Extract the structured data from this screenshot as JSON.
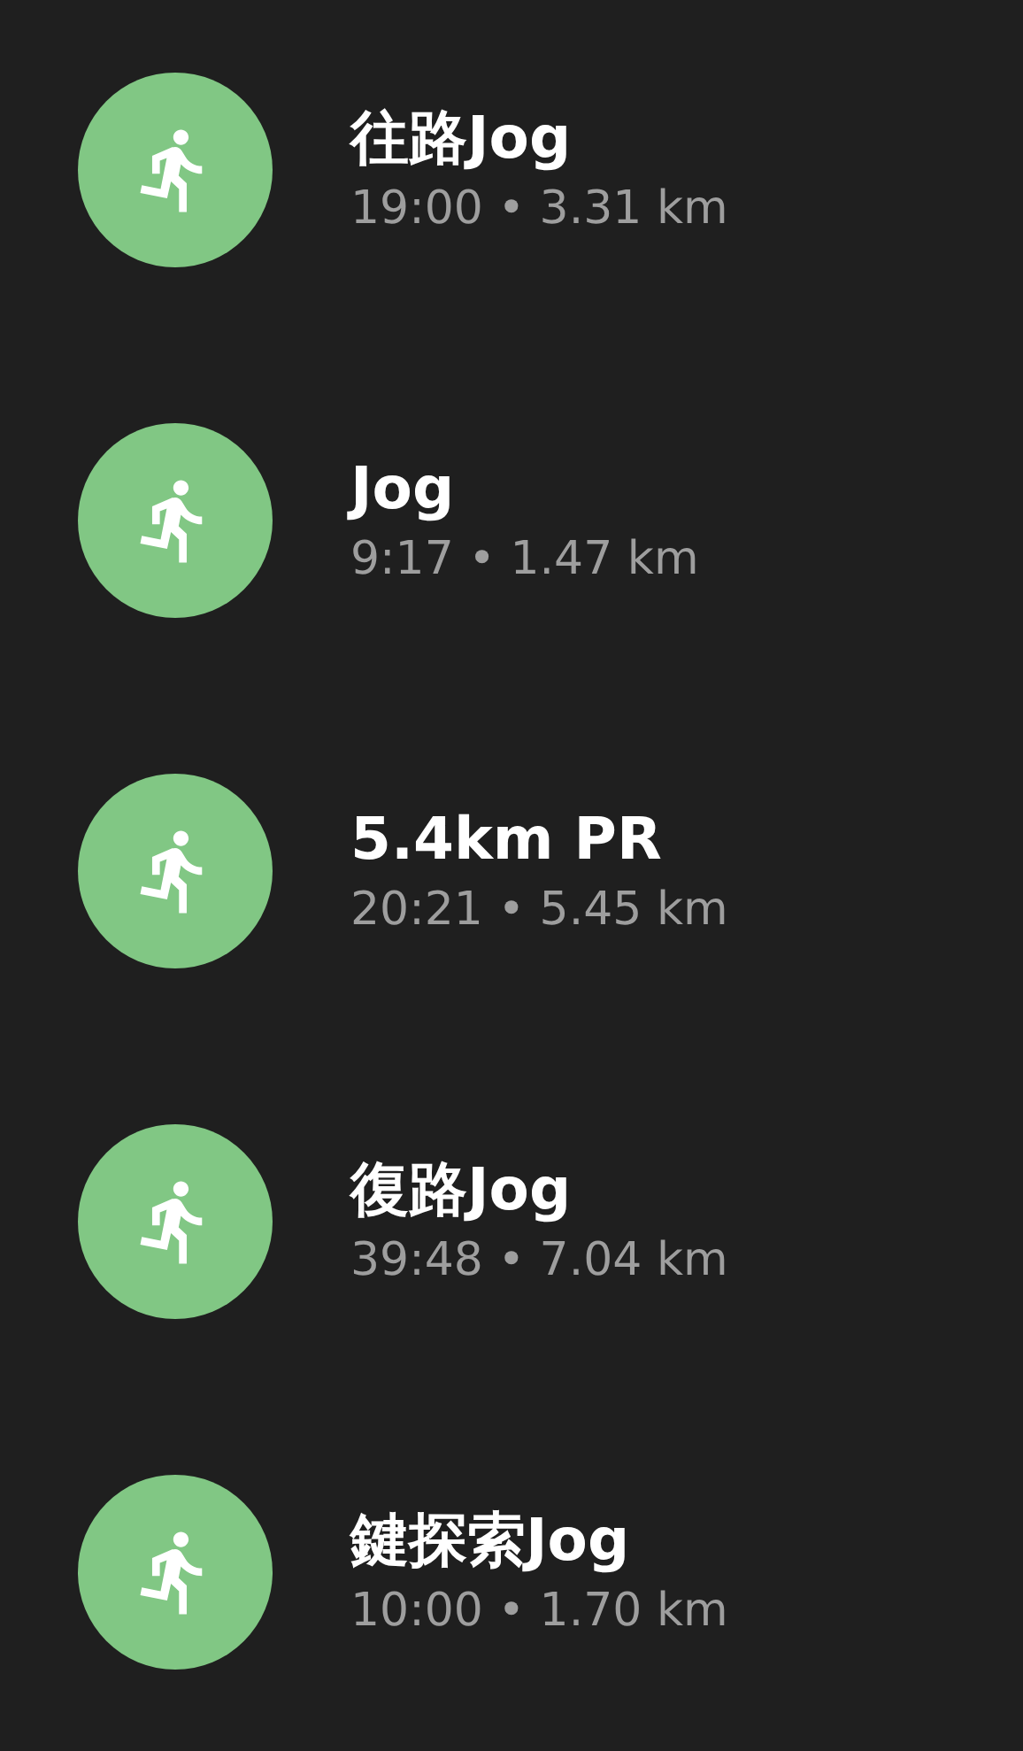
{
  "activities": [
    {
      "title": "往路Jog",
      "detail": "19:00 • 3.31 km"
    },
    {
      "title": "Jog",
      "detail": "9:17 • 1.47 km"
    },
    {
      "title": "5.4km PR",
      "detail": "20:21 • 5.45 km"
    },
    {
      "title": "復路Jog",
      "detail": "39:48 • 7.04 km"
    },
    {
      "title": "鍵探索Jog",
      "detail": "10:00 • 1.70 km"
    }
  ]
}
